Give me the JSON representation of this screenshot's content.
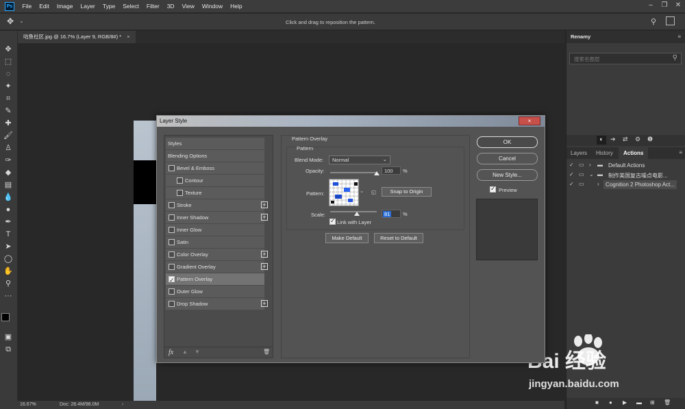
{
  "menubar": {
    "logo": "Ps",
    "items": [
      "File",
      "Edit",
      "Image",
      "Layer",
      "Type",
      "Select",
      "Filter",
      "3D",
      "View",
      "Window",
      "Help"
    ]
  },
  "options": {
    "hint": "Click and drag to reposition the pattern."
  },
  "document": {
    "tab_title": "咕鱼社区.jpg @ 16.7% (Layer 9, RGB/8#) *",
    "close": "×"
  },
  "status": {
    "zoom": "16.67%",
    "doc": "Doc: 28.4M/98.0M"
  },
  "right_panel": {
    "renamy": {
      "title": "Renamy",
      "search_placeholder": "搜索名图层"
    },
    "tabs": [
      "Layers",
      "History",
      "Actions"
    ],
    "actions": [
      {
        "label": "Default Actions"
      },
      {
        "label": "制作美国复古噪点电影..."
      },
      {
        "label": "Cognition 2 Photoshop Act..."
      }
    ]
  },
  "dialog": {
    "title": "Layer Style",
    "close": "×",
    "styles_header": "Styles",
    "blending_options": "Blending Options",
    "items": [
      {
        "label": "Bevel & Emboss",
        "checked": false,
        "plus": false
      },
      {
        "label": "Contour",
        "checked": false,
        "plus": false
      },
      {
        "label": "Texture",
        "checked": false,
        "plus": false
      },
      {
        "label": "Stroke",
        "checked": false,
        "plus": true
      },
      {
        "label": "Inner Shadow",
        "checked": false,
        "plus": true
      },
      {
        "label": "Inner Glow",
        "checked": false,
        "plus": false
      },
      {
        "label": "Satin",
        "checked": false,
        "plus": false
      },
      {
        "label": "Color Overlay",
        "checked": false,
        "plus": true
      },
      {
        "label": "Gradient Overlay",
        "checked": false,
        "plus": true
      },
      {
        "label": "Pattern Overlay",
        "checked": true,
        "plus": false
      },
      {
        "label": "Outer Glow",
        "checked": false,
        "plus": false
      },
      {
        "label": "Drop Shadow",
        "checked": false,
        "plus": true
      }
    ],
    "fx_label": "fx",
    "pattern_overlay": {
      "group_title": "Pattern Overlay",
      "subgroup": "Pattern",
      "blend_label": "Blend Mode:",
      "blend_value": "Normal",
      "opacity_label": "Opacity:",
      "opacity_value": "100",
      "opacity_fraction": 1.0,
      "percent": "%",
      "pattern_label": "Pattern:",
      "snap_button": "Snap to Origin",
      "scale_label": "Scale:",
      "scale_value": "81",
      "scale_fraction": 0.81,
      "link_label": "Link with Layer",
      "make_default": "Make Default",
      "reset_default": "Reset to Default"
    },
    "buttons": {
      "ok": "OK",
      "cancel": "Cancel",
      "new_style": "New Style...",
      "preview": "Preview"
    }
  },
  "watermark": {
    "brand": "Bai 经验",
    "url": "jingyan.baidu.com"
  }
}
